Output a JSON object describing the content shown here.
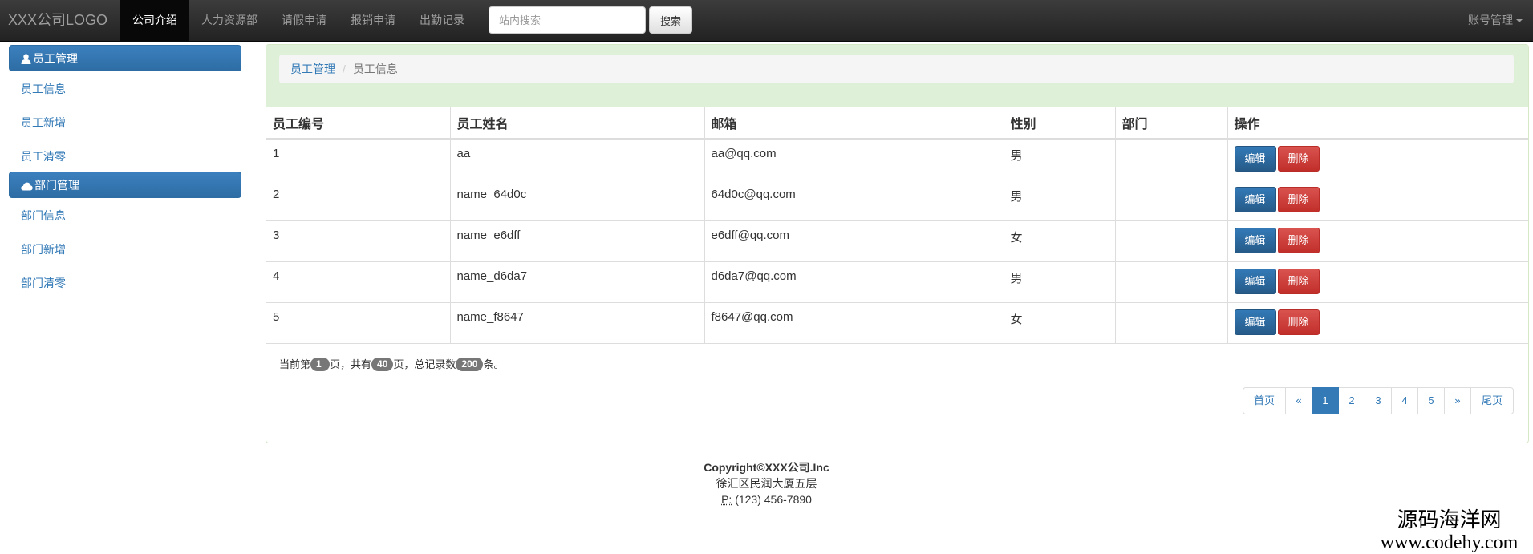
{
  "navbar": {
    "brand": "XXX公司LOGO",
    "items": [
      {
        "label": "公司介绍",
        "active": true
      },
      {
        "label": "人力资源部",
        "active": false
      },
      {
        "label": "请假申请",
        "active": false
      },
      {
        "label": "报销申请",
        "active": false
      },
      {
        "label": "出勤记录",
        "active": false
      }
    ],
    "search": {
      "placeholder": "站内搜索",
      "value": "",
      "button": "搜索"
    },
    "account": "账号管理"
  },
  "sidebar": {
    "sections": [
      {
        "title": "员工管理",
        "icon": "user-icon",
        "links": [
          "员工信息",
          "员工新增",
          "员工清零"
        ]
      },
      {
        "title": "部门管理",
        "icon": "cloud-icon",
        "links": [
          "部门信息",
          "部门新增",
          "部门清零"
        ]
      }
    ]
  },
  "breadcrumb": {
    "parent": "员工管理",
    "separator": "/",
    "current": "员工信息"
  },
  "table": {
    "columns": [
      "员工编号",
      "员工姓名",
      "邮箱",
      "性别",
      "部门",
      "操作"
    ],
    "rows": [
      {
        "id": "1",
        "name": "aa",
        "email": "aa@qq.com",
        "gender": "男",
        "dept": ""
      },
      {
        "id": "2",
        "name": "name_64d0c",
        "email": "64d0c@qq.com",
        "gender": "男",
        "dept": ""
      },
      {
        "id": "3",
        "name": "name_e6dff",
        "email": "e6dff@qq.com",
        "gender": "女",
        "dept": ""
      },
      {
        "id": "4",
        "name": "name_d6da7",
        "email": "d6da7@qq.com",
        "gender": "男",
        "dept": ""
      },
      {
        "id": "5",
        "name": "name_f8647",
        "email": "f8647@qq.com",
        "gender": "女",
        "dept": ""
      }
    ],
    "edit_label": "编辑",
    "delete_label": "删除"
  },
  "page_info": {
    "prefix": "当前第",
    "current": "1",
    "mid1": "页，共有",
    "total_pages": "40",
    "mid2": "页，总记录数",
    "total_records": "200",
    "suffix": "条。"
  },
  "pagination": {
    "first": "首页",
    "prev": "«",
    "pages": [
      "1",
      "2",
      "3",
      "4",
      "5"
    ],
    "active": "1",
    "next": "»",
    "last": "尾页"
  },
  "footer": {
    "copyright": "Copyright©XXX公司.Inc",
    "address": "徐汇区民润大厦五层",
    "phone_label": "P:",
    "phone": "(123) 456-7890"
  },
  "watermark": {
    "line1": "源码海洋网",
    "line2": "www.codehy.com"
  },
  "colors": {
    "primary": "#337ab7",
    "danger": "#d9534f",
    "panel_heading": "#dff0d8",
    "navbar": "#222222"
  }
}
